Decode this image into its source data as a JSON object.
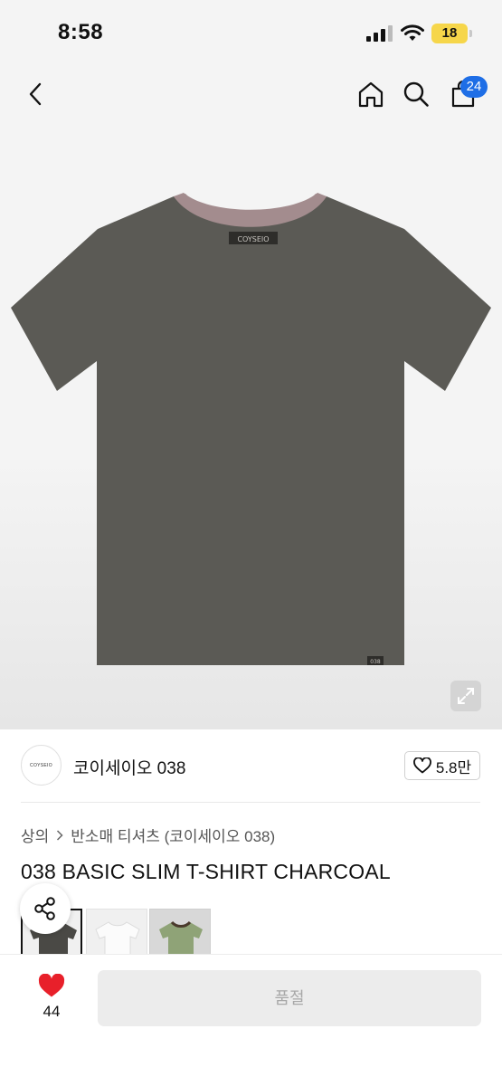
{
  "status_bar": {
    "time": "8:58",
    "battery_level": "18",
    "signal_icon": "cellular-signal-icon",
    "wifi_icon": "wifi-icon"
  },
  "nav": {
    "back_icon": "chevron-left-icon",
    "home_icon": "home-icon",
    "search_icon": "search-icon",
    "bag_icon": "shopping-bag-icon",
    "bag_count": "24"
  },
  "hero": {
    "shirt_label": "COYSEIO",
    "shirt_tag": "038",
    "expand_icon": "expand-icon"
  },
  "brand": {
    "logo_text": "COYSEIO",
    "name": "코이세이오 038",
    "like_count": "5.8만"
  },
  "breadcrumb": {
    "category": "상의",
    "subcategory": "반소매 티셔츠 (코이세이오 038)"
  },
  "product": {
    "title": "038 BASIC SLIM T-SHIRT CHARCOAL"
  },
  "share_icon": "share-icon",
  "bottom": {
    "wish_count": "44",
    "soldout_label": "품절"
  },
  "colors": {
    "accent_badge": "#1e6ee6",
    "heart": "#e8202a",
    "shirt_charcoal": "#5b5a55",
    "collar_pink": "#a38c8e"
  }
}
